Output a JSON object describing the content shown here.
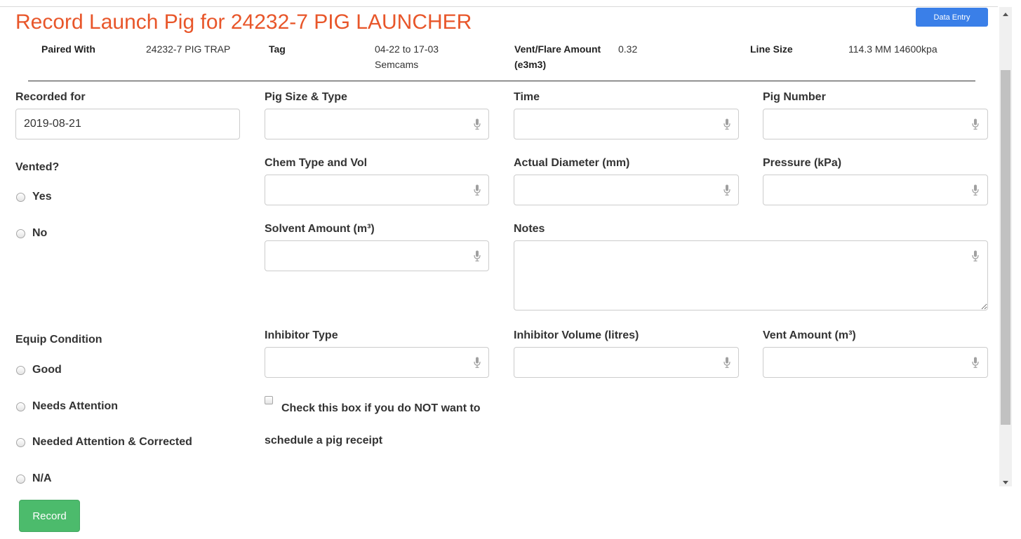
{
  "header": {
    "title": "Record Launch Pig for 24232-7 PIG LAUNCHER",
    "mode_button": "Data Entry"
  },
  "info": {
    "paired_with_label": "Paired With",
    "paired_with_value": "24232-7 PIG TRAP",
    "tag_label": "Tag",
    "tag_value_line1": "04-22 to 17-03",
    "tag_value_line2": "Semcams",
    "vent_flare_label_line1": "Vent/Flare Amount",
    "vent_flare_label_line2": "(e3m3)",
    "vent_flare_value": "0.32",
    "line_size_label": "Line Size",
    "line_size_value": "114.3 MM 14600kpa"
  },
  "form": {
    "recorded_for_label": "Recorded for",
    "recorded_for_value": "2019-08-21",
    "pig_size_type_label": "Pig Size & Type",
    "time_label": "Time",
    "pig_number_label": "Pig Number",
    "vented_label": "Vented?",
    "vented_options": [
      "Yes",
      "No"
    ],
    "chem_type_vol_label": "Chem Type and Vol",
    "actual_diameter_label": "Actual Diameter (mm)",
    "pressure_label": "Pressure (kPa)",
    "solvent_amount_label": "Solvent Amount (m³)",
    "notes_label": "Notes",
    "equip_condition_label": "Equip Condition",
    "equip_condition_options": [
      "Good",
      "Needs Attention",
      "Needed Attention & Corrected",
      "N/A"
    ],
    "inhibitor_type_label": "Inhibitor Type",
    "inhibitor_volume_label": "Inhibitor Volume (litres)",
    "vent_amount_label": "Vent Amount (m³)",
    "no_receipt_checkbox_label": "Check this box if you do NOT want to schedule a pig receipt",
    "record_button": "Record"
  },
  "icons": {
    "field_icon": "microphone-icon",
    "icon_color": "#a0a0a0"
  },
  "colors": {
    "title": "#e8562a",
    "mode_button": "#3a7fe8",
    "record_button": "#4cbb6c"
  }
}
